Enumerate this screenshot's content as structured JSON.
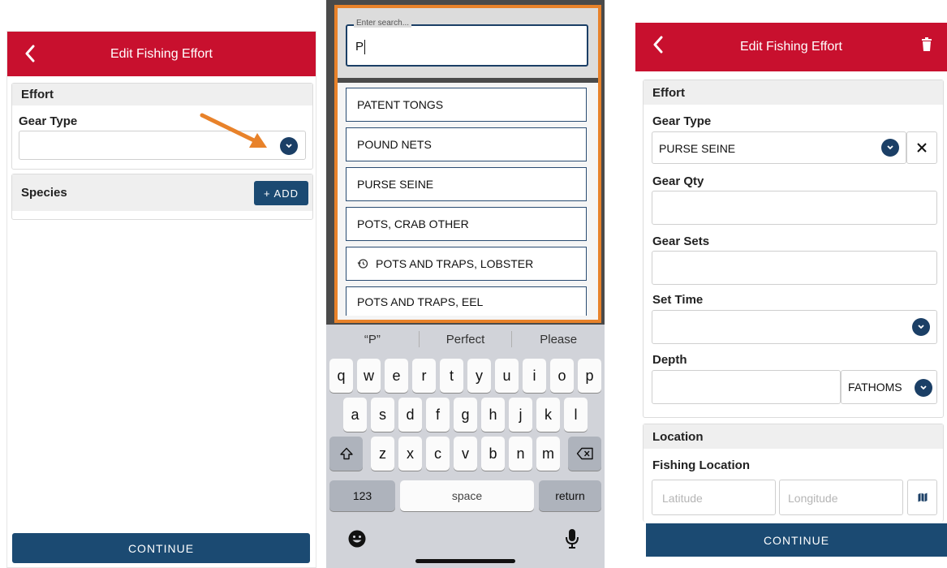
{
  "left": {
    "header_title": "Edit Fishing Effort",
    "effort_title": "Effort",
    "gear_type_label": "Gear Type",
    "species_title": "Species",
    "add_label": "+ ADD",
    "continue_label": "CONTINUE"
  },
  "middle": {
    "search_placeholder": "Enter search...",
    "search_value": "P",
    "options": [
      "PATENT TONGS",
      "POUND NETS",
      "PURSE SEINE",
      "POTS, CRAB OTHER",
      "POTS AND TRAPS, LOBSTER",
      "POTS AND TRAPS, EEL"
    ],
    "recent_option_index": 4,
    "suggestions": [
      "“P”",
      "Perfect",
      "Please"
    ],
    "keyboard": {
      "row1": [
        "q",
        "w",
        "e",
        "r",
        "t",
        "y",
        "u",
        "i",
        "o",
        "p"
      ],
      "row2": [
        "a",
        "s",
        "d",
        "f",
        "g",
        "h",
        "j",
        "k",
        "l"
      ],
      "row3": [
        "z",
        "x",
        "c",
        "v",
        "b",
        "n",
        "m"
      ],
      "numbers_label": "123",
      "space_label": "space",
      "return_label": "return"
    }
  },
  "right": {
    "header_title": "Edit Fishing Effort",
    "effort_title": "Effort",
    "gear_type_label": "Gear Type",
    "gear_type_value": "PURSE SEINE",
    "gear_qty_label": "Gear Qty",
    "gear_sets_label": "Gear Sets",
    "set_time_label": "Set Time",
    "depth_label": "Depth",
    "depth_unit": "FATHOMS",
    "location_title": "Location",
    "fishing_location_label": "Fishing Location",
    "latitude_placeholder": "Latitude",
    "longitude_placeholder": "Longitude",
    "continue_label": "CONTINUE"
  },
  "colors": {
    "header_red": "#c8102e",
    "navy": "#1b4a72",
    "highlight_orange": "#e8822a"
  }
}
